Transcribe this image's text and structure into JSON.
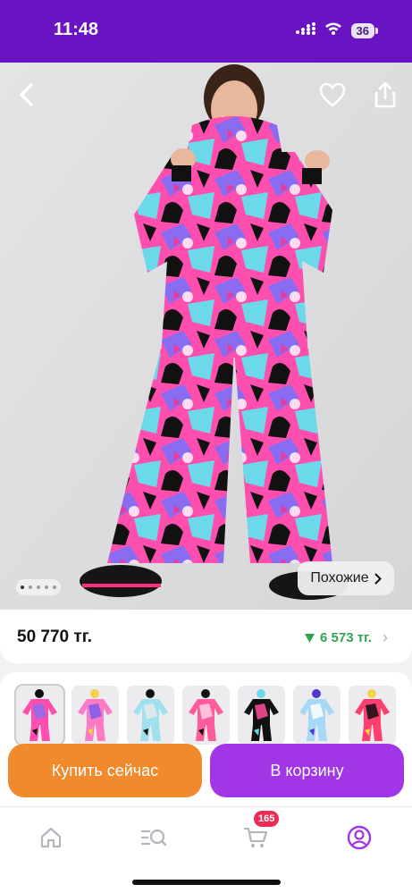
{
  "status_bar": {
    "time": "11:48",
    "battery": "36"
  },
  "product": {
    "price": "50 770 тг.",
    "discount": "6 573 тг.",
    "similar_label": "Похожие",
    "gallery_pages": 5,
    "gallery_current": 1
  },
  "variants": {
    "count": 7
  },
  "actions": {
    "buy_now": "Купить сейчас",
    "add_to_cart": "В корзину"
  },
  "tab_bar": {
    "cart_badge": "165"
  },
  "colors": {
    "status_bar": "#6a13c2",
    "buy_now": "#f08a2c",
    "add_to_cart": "#a235e6",
    "discount": "#2ea650",
    "badge": "#ef2b55",
    "active_tab": "#a235e6"
  },
  "icons": [
    "back-icon",
    "heart-icon",
    "share-icon",
    "chevron-right-icon",
    "home-icon",
    "search-catalog-icon",
    "cart-icon",
    "profile-icon"
  ]
}
